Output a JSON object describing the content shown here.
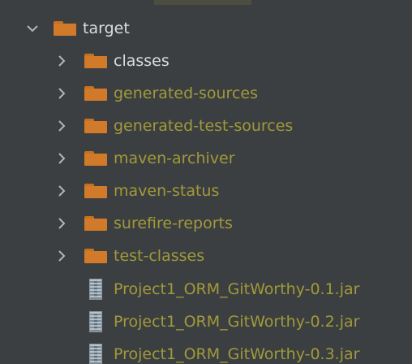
{
  "tree": {
    "root": {
      "label": "target",
      "expanded": true,
      "icon": "folder-icon"
    },
    "children": [
      {
        "label": "classes",
        "type": "folder",
        "expanded": false,
        "color": "#dcdcdc"
      },
      {
        "label": "generated-sources",
        "type": "folder",
        "expanded": false,
        "color": "#a09a3a"
      },
      {
        "label": "generated-test-sources",
        "type": "folder",
        "expanded": false,
        "color": "#a09a3a"
      },
      {
        "label": "maven-archiver",
        "type": "folder",
        "expanded": false,
        "color": "#a09a3a"
      },
      {
        "label": "maven-status",
        "type": "folder",
        "expanded": false,
        "color": "#a09a3a"
      },
      {
        "label": "surefire-reports",
        "type": "folder",
        "expanded": false,
        "color": "#a09a3a"
      },
      {
        "label": "test-classes",
        "type": "folder",
        "expanded": false,
        "color": "#a09a3a"
      },
      {
        "label": "Project1_ORM_GitWorthy-0.1.jar",
        "type": "jar",
        "color": "#a09a3a"
      },
      {
        "label": "Project1_ORM_GitWorthy-0.2.jar",
        "type": "jar",
        "color": "#a09a3a"
      },
      {
        "label": "Project1_ORM_GitWorthy-0.3.jar",
        "type": "jar",
        "color": "#a09a3a"
      }
    ]
  },
  "colors": {
    "background": "#3c3f41",
    "folder": "#d07a2a",
    "excluded_text": "#a09a3a",
    "normal_text": "#dcdcdc",
    "chevron": "#b4b4b4"
  }
}
